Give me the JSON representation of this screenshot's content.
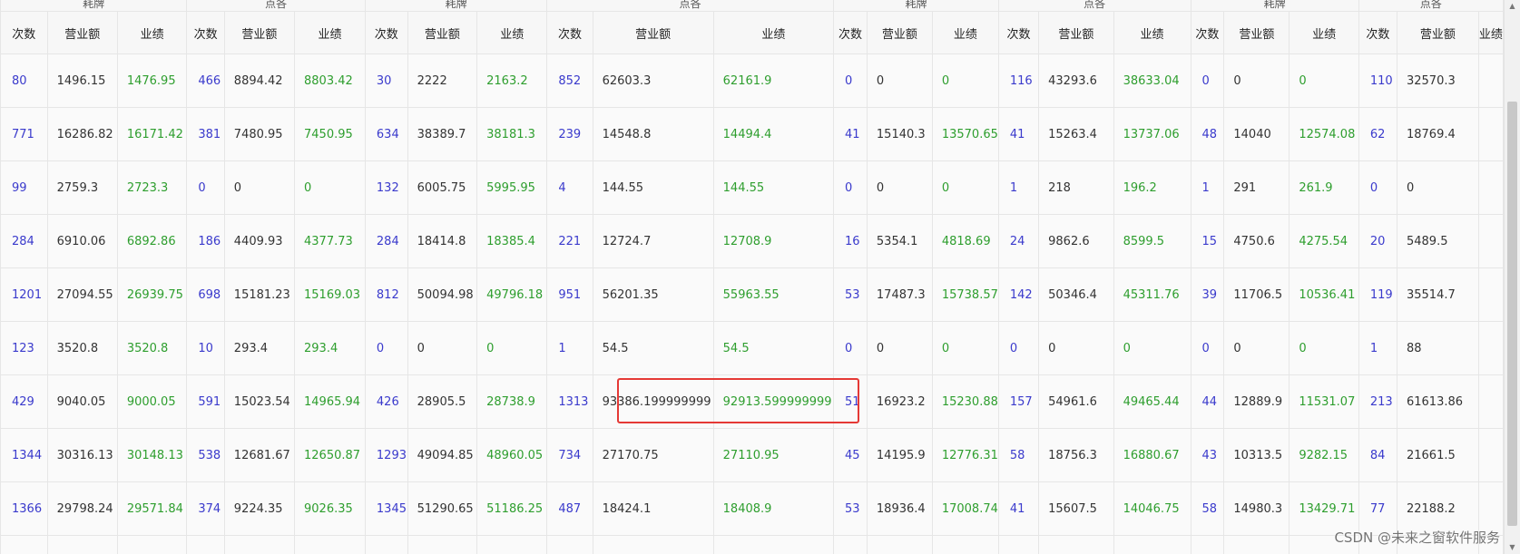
{
  "headers": {
    "groups": [
      "耗牌",
      "点各",
      "耗牌",
      "点各",
      "耗牌",
      "点各",
      "耗牌",
      "点各"
    ],
    "sub": [
      "次数",
      "营业额",
      "业绩"
    ]
  },
  "rows": [
    [
      [
        "80",
        "1496.15",
        "1476.95"
      ],
      [
        "466",
        "8894.42",
        "8803.42"
      ],
      [
        "30",
        "2222",
        "2163.2"
      ],
      [
        "852",
        "62603.3",
        "62161.9"
      ],
      [
        "0",
        "0",
        "0"
      ],
      [
        "116",
        "43293.6",
        "38633.04"
      ],
      [
        "0",
        "0",
        "0"
      ],
      [
        "110",
        "32570.3",
        ""
      ]
    ],
    [
      [
        "771",
        "16286.82",
        "16171.42"
      ],
      [
        "381",
        "7480.95",
        "7450.95"
      ],
      [
        "634",
        "38389.7",
        "38181.3"
      ],
      [
        "239",
        "14548.8",
        "14494.4"
      ],
      [
        "41",
        "15140.3",
        "13570.65"
      ],
      [
        "41",
        "15263.4",
        "13737.06"
      ],
      [
        "48",
        "14040",
        "12574.08"
      ],
      [
        "62",
        "18769.4",
        ""
      ]
    ],
    [
      [
        "99",
        "2759.3",
        "2723.3"
      ],
      [
        "0",
        "0",
        "0"
      ],
      [
        "132",
        "6005.75",
        "5995.95"
      ],
      [
        "4",
        "144.55",
        "144.55"
      ],
      [
        "0",
        "0",
        "0"
      ],
      [
        "1",
        "218",
        "196.2"
      ],
      [
        "1",
        "291",
        "261.9"
      ],
      [
        "0",
        "0",
        ""
      ]
    ],
    [
      [
        "284",
        "6910.06",
        "6892.86"
      ],
      [
        "186",
        "4409.93",
        "4377.73"
      ],
      [
        "284",
        "18414.8",
        "18385.4"
      ],
      [
        "221",
        "12724.7",
        "12708.9"
      ],
      [
        "16",
        "5354.1",
        "4818.69"
      ],
      [
        "24",
        "9862.6",
        "8599.5"
      ],
      [
        "15",
        "4750.6",
        "4275.54"
      ],
      [
        "20",
        "5489.5",
        ""
      ]
    ],
    [
      [
        "1201",
        "27094.55",
        "26939.75"
      ],
      [
        "698",
        "15181.23",
        "15169.03"
      ],
      [
        "812",
        "50094.98",
        "49796.18"
      ],
      [
        "951",
        "56201.35",
        "55963.55"
      ],
      [
        "53",
        "17487.3",
        "15738.57"
      ],
      [
        "142",
        "50346.4",
        "45311.76"
      ],
      [
        "39",
        "11706.5",
        "10536.41"
      ],
      [
        "119",
        "35514.7",
        ""
      ]
    ],
    [
      [
        "123",
        "3520.8",
        "3520.8"
      ],
      [
        "10",
        "293.4",
        "293.4"
      ],
      [
        "0",
        "0",
        "0"
      ],
      [
        "1",
        "54.5",
        "54.5"
      ],
      [
        "0",
        "0",
        "0"
      ],
      [
        "0",
        "0",
        "0"
      ],
      [
        "0",
        "0",
        "0"
      ],
      [
        "1",
        "88",
        ""
      ]
    ],
    [
      [
        "429",
        "9040.05",
        "9000.05"
      ],
      [
        "591",
        "15023.54",
        "14965.94"
      ],
      [
        "426",
        "28905.5",
        "28738.9"
      ],
      [
        "1313",
        "93386.199999999",
        "92913.599999999"
      ],
      [
        "51",
        "16923.2",
        "15230.88"
      ],
      [
        "157",
        "54961.6",
        "49465.44"
      ],
      [
        "44",
        "12889.9",
        "11531.07"
      ],
      [
        "213",
        "61613.86",
        ""
      ]
    ],
    [
      [
        "1344",
        "30316.13",
        "30148.13"
      ],
      [
        "538",
        "12681.67",
        "12650.87"
      ],
      [
        "1293",
        "49094.85",
        "48960.05"
      ],
      [
        "734",
        "27170.75",
        "27110.95"
      ],
      [
        "45",
        "14195.9",
        "12776.31"
      ],
      [
        "58",
        "18756.3",
        "16880.67"
      ],
      [
        "43",
        "10313.5",
        "9282.15"
      ],
      [
        "84",
        "21661.5",
        ""
      ]
    ],
    [
      [
        "1366",
        "29798.24",
        "29571.84"
      ],
      [
        "374",
        "9224.35",
        "9026.35"
      ],
      [
        "1345",
        "51290.65",
        "51186.25"
      ],
      [
        "487",
        "18424.1",
        "18408.9"
      ],
      [
        "53",
        "18936.4",
        "17008.74"
      ],
      [
        "41",
        "15607.5",
        "14046.75"
      ],
      [
        "58",
        "14980.3",
        "13429.71"
      ],
      [
        "77",
        "22188.2",
        ""
      ]
    ],
    [
      [
        "",
        "",
        ""
      ],
      [
        "",
        "",
        ""
      ],
      [
        "",
        "",
        ""
      ],
      [
        "",
        "",
        ""
      ],
      [
        "",
        "",
        ""
      ],
      [
        "",
        "",
        ""
      ],
      [
        "",
        "",
        ""
      ],
      [
        "",
        "",
        ""
      ]
    ]
  ],
  "highlight": {
    "row": 6,
    "group": 3
  },
  "colors": {
    "count": "#3a3acc",
    "revenue": "#333333",
    "performance": "#2e9e2e",
    "highlight_border": "#e53935"
  },
  "watermark": "CSDN @未来之窗软件服务"
}
